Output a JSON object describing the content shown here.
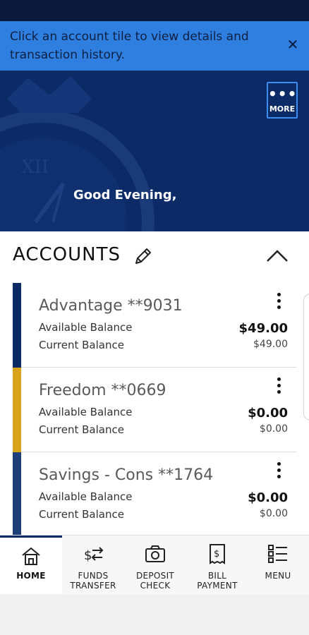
{
  "banner": {
    "message": "Click an account tile to view details and transaction history.",
    "close_icon": "close-icon"
  },
  "hero": {
    "more_label": "MORE",
    "greeting": "Good Evening,"
  },
  "accounts": {
    "title": "ACCOUNTS",
    "items": [
      {
        "name": "Advantage **9031",
        "available_label": "Available Balance",
        "available_amount": "$49.00",
        "current_label": "Current Balance",
        "current_amount": "$49.00",
        "stripe_color": "#0c2a66"
      },
      {
        "name": "Freedom **0669",
        "available_label": "Available Balance",
        "available_amount": "$0.00",
        "current_label": "Current Balance",
        "current_amount": "$0.00",
        "stripe_color": "#d9a21b"
      },
      {
        "name": "Savings - Cons **1764",
        "available_label": "Available Balance",
        "available_amount": "$0.00",
        "current_label": "Current Balance",
        "current_amount": "$0.00",
        "stripe_color": "#1d3f7a"
      }
    ]
  },
  "nav": {
    "items": [
      {
        "line1": "HOME",
        "line2": "",
        "icon": "home-icon",
        "active": true
      },
      {
        "line1": "FUNDS",
        "line2": "TRANSFER",
        "icon": "funds-transfer-icon",
        "active": false
      },
      {
        "line1": "DEPOSIT",
        "line2": "CHECK",
        "icon": "camera-icon",
        "active": false
      },
      {
        "line1": "BILL",
        "line2": "PAYMENT",
        "icon": "bill-icon",
        "active": false
      },
      {
        "line1": "MENU",
        "line2": "",
        "icon": "menu-list-icon",
        "active": false
      }
    ]
  },
  "colors": {
    "brand_navy": "#0c2a66",
    "banner_blue": "#2f7fe0",
    "accent_gold": "#d9a21b"
  }
}
